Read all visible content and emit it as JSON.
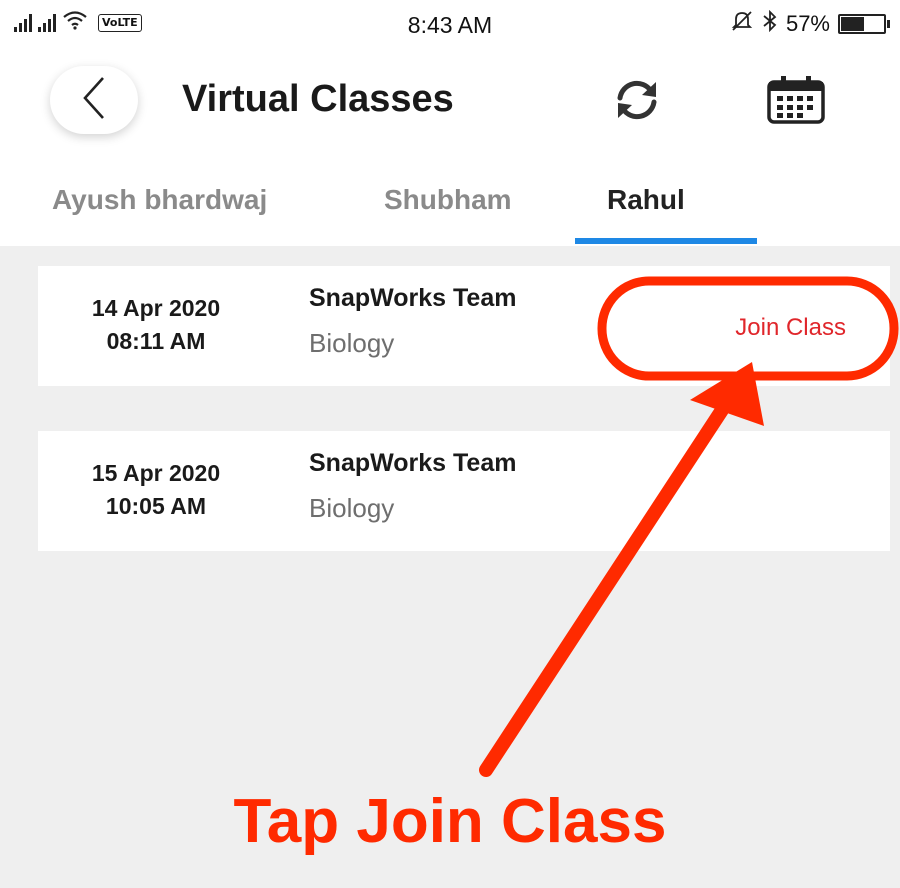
{
  "status_bar": {
    "volte": "VoLTE",
    "time": "8:43 AM",
    "battery_text": "57%",
    "battery_level": 0.57,
    "icons": [
      "signal-icon",
      "wifi-icon",
      "mute-icon",
      "bluetooth-icon",
      "battery-icon"
    ]
  },
  "header": {
    "title": "Virtual Classes",
    "icons": [
      "back-arrow-icon",
      "refresh-icon",
      "calendar-icon"
    ]
  },
  "tabs": [
    {
      "label": "Ayush bhardwaj",
      "active": false
    },
    {
      "label": "Shubham",
      "active": false
    },
    {
      "label": "Rahul",
      "active": true
    }
  ],
  "classes": [
    {
      "date": "14 Apr 2020",
      "time": "08:11 AM",
      "team": "SnapWorks Team",
      "subject": "Biology",
      "action": "Join Class"
    },
    {
      "date": "15 Apr 2020",
      "time": "10:05 AM",
      "team": "SnapWorks Team",
      "subject": "Biology"
    }
  ],
  "annotation": {
    "caption": "Tap Join Class",
    "color": "#ff2a00"
  },
  "colors": {
    "accent": "#1e88e5",
    "join": "#e0262b",
    "background": "#efefef"
  }
}
